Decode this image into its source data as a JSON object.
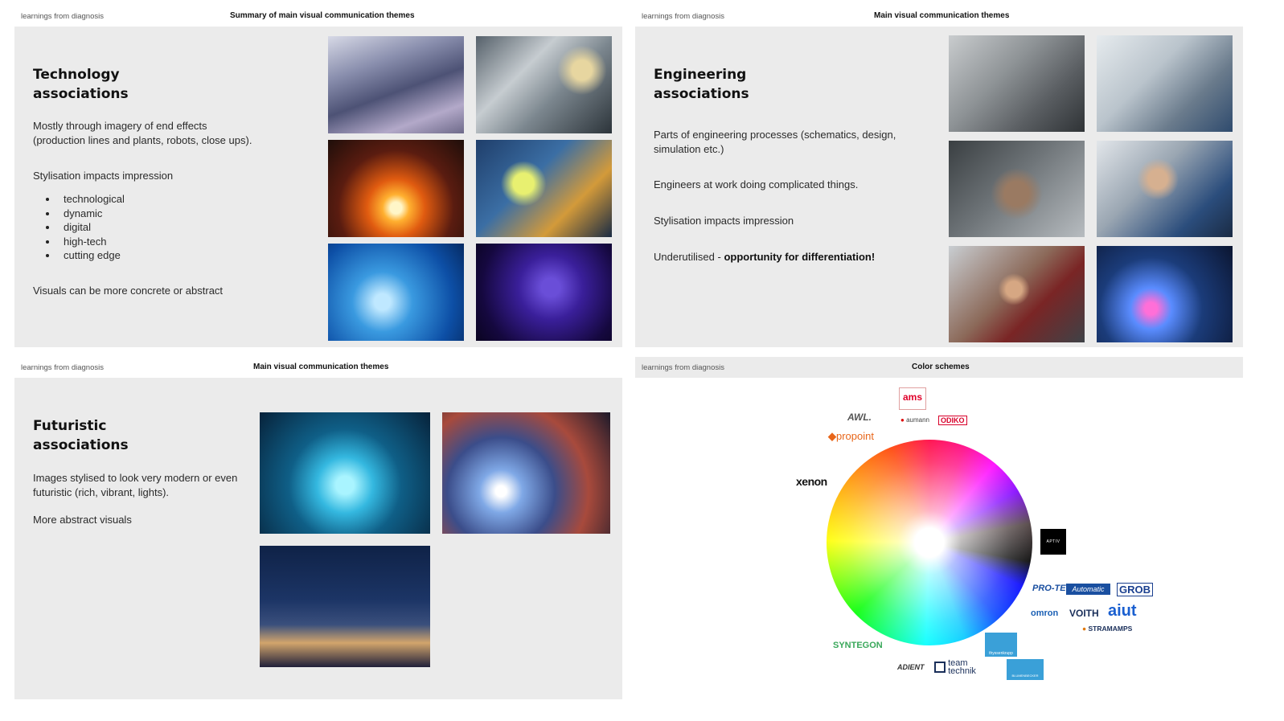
{
  "slides": {
    "technology": {
      "header_left": "learnings from diagnosis",
      "header_center": "Summary of main visual communication themes",
      "title_line1": "Technology",
      "title_line2": "associations",
      "p1_line1": "Mostly through imagery of end effects",
      "p1_line2": "(production lines and plants, robots, close ups).",
      "p2": "Stylisation impacts impression",
      "bullets": [
        "technological",
        "dynamic",
        "digital",
        "high-tech",
        "cutting edge"
      ],
      "p3": "Visuals can be more concrete or abstract"
    },
    "engineering": {
      "header_left": "learnings from diagnosis",
      "header_center": "Main visual communication themes",
      "title_line1": "Engineering",
      "title_line2": "associations",
      "p1_line1": "Parts of engineering processes (schematics, design,",
      "p1_line2": "simulation etc.)",
      "p2": "Engineers at work doing complicated things.",
      "p3": "Stylisation impacts impression",
      "p4_prefix": "Underutilised - ",
      "p4_bold": "opportunity for differentiation!"
    },
    "futuristic": {
      "header_left": "learnings from diagnosis",
      "header_center": "Main visual communication themes",
      "title_line1": "Futuristic",
      "title_line2": "associations",
      "p1_line1": "Images stylised to look very modern or even",
      "p1_line2": "futuristic (rich, vibrant, lights).",
      "p2": "More abstract visuals"
    },
    "colors": {
      "header_left": "learnings from diagnosis",
      "header_center": "Color schemes",
      "logos": {
        "ams": "ams",
        "awl": "AWL.",
        "aumann": "aumann",
        "odiko": "ODIKO",
        "propoint": "propoint",
        "xenon": "xenon",
        "aptiv": "APTIV",
        "pro_tech": "PRO-TECH",
        "automatic": "Automatic",
        "grob": "GROB",
        "omron": "omron",
        "voith": "VOITH",
        "aiut": "aiut",
        "strama": "STRAMAMPS",
        "syntegon": "SYNTEGON",
        "thyssenkrupp": "thyssenkrupp",
        "adient": "ADIENT",
        "teamtechnik": "team technik",
        "blumenbecker": "BLUMENBECKER"
      }
    }
  }
}
